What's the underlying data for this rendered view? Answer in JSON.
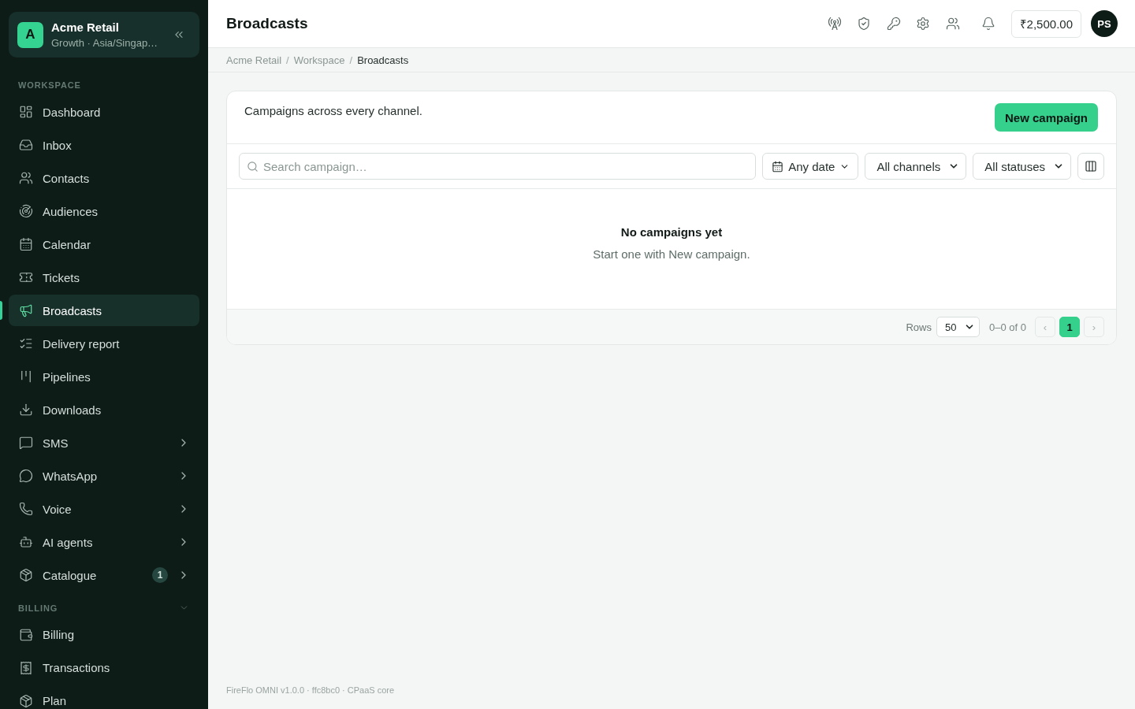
{
  "sidebar": {
    "org": {
      "initial": "A",
      "name": "Acme Retail",
      "subtitle": "Growth · Asia/Singap…"
    },
    "sections": [
      {
        "label": "WORKSPACE",
        "kind": "static",
        "items": [
          {
            "label": "Dashboard",
            "kind": "link",
            "selected": false
          },
          {
            "label": "Inbox",
            "kind": "link",
            "selected": false
          },
          {
            "label": "Contacts",
            "kind": "link",
            "selected": false
          },
          {
            "label": "Audiences",
            "kind": "link",
            "selected": false
          },
          {
            "label": "Calendar",
            "kind": "link",
            "selected": false
          },
          {
            "label": "Tickets",
            "kind": "link",
            "selected": false
          },
          {
            "label": "Broadcasts",
            "kind": "link",
            "selected": true
          },
          {
            "label": "Delivery report",
            "kind": "link",
            "selected": false
          },
          {
            "label": "Pipelines",
            "kind": "link",
            "selected": false
          },
          {
            "label": "Downloads",
            "kind": "link",
            "selected": false
          },
          {
            "label": "SMS",
            "kind": "group",
            "selected": false
          },
          {
            "label": "WhatsApp",
            "kind": "group",
            "selected": false
          },
          {
            "label": "Voice",
            "kind": "group",
            "selected": false
          },
          {
            "label": "AI agents",
            "kind": "group",
            "selected": false
          },
          {
            "label": "Catalogue",
            "kind": "group",
            "selected": false,
            "badge": "1"
          }
        ]
      },
      {
        "label": "BILLING",
        "kind": "collapsible",
        "expanded": true,
        "items": [
          {
            "label": "Billing",
            "kind": "link",
            "selected": false
          },
          {
            "label": "Transactions",
            "kind": "link",
            "selected": false
          },
          {
            "label": "Plan",
            "kind": "link",
            "selected": false
          }
        ]
      }
    ]
  },
  "topbar": {
    "title": "Broadcasts",
    "balance": "₹2,500.00",
    "avatar": "PS"
  },
  "breadcrumb": [
    {
      "kind": "link",
      "label": "Acme Retail"
    },
    {
      "kind": "separator",
      "label": "/"
    },
    {
      "kind": "link",
      "label": "Workspace"
    },
    {
      "kind": "separator",
      "label": "/"
    },
    {
      "kind": "current",
      "label": "Broadcasts"
    }
  ],
  "card": {
    "description": "Campaigns across every channel.",
    "primary_button": "New campaign",
    "search": {
      "placeholder": "Search campaign…"
    },
    "filters": [
      {
        "kind": "date",
        "label": "Any date"
      },
      {
        "kind": "select",
        "label": "All channels"
      },
      {
        "kind": "select",
        "label": "All statuses"
      }
    ],
    "empty_state": {
      "title": "No campaigns yet",
      "message": "Start one with New campaign."
    },
    "pagination": {
      "rows_label": "Rows",
      "rows_value": "50",
      "range": "0–0 of 0",
      "prev": {
        "label": "‹",
        "disabled": true
      },
      "pages": [
        {
          "label": "1",
          "selected": true
        }
      ],
      "next": {
        "label": "›",
        "disabled": true
      }
    }
  },
  "footer": "FireFlo OMNI v1.0.0 · ffc8bc0 · CPaaS core"
}
